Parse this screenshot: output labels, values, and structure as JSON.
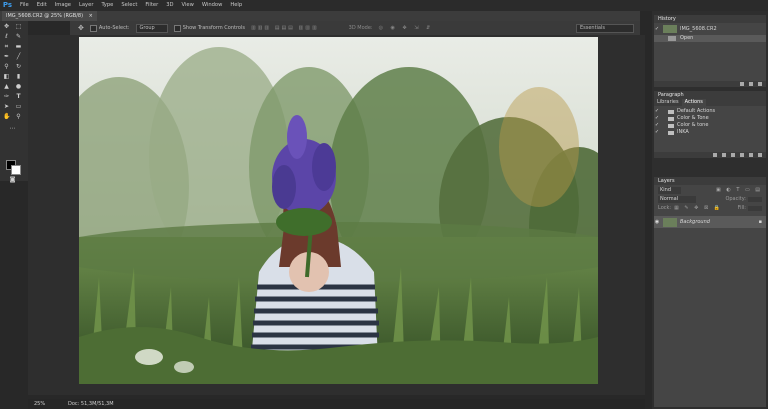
{
  "app": {
    "logo": "Ps",
    "menu": [
      "File",
      "Edit",
      "Image",
      "Layer",
      "Type",
      "Select",
      "Filter",
      "3D",
      "View",
      "Window",
      "Help"
    ]
  },
  "document": {
    "tab_title": "IMG_5608.CR2 @ 25% (RGB/8)",
    "close": "×"
  },
  "options": {
    "auto_select_label": "Auto-Select:",
    "auto_select_value": "Group",
    "show_transform": "Show Transform Controls",
    "mode_3d": "3D Mode:",
    "workspace": "Essentials"
  },
  "status": {
    "zoom": "25%",
    "doc": "Doc: 51,3M/51,3M"
  },
  "history": {
    "title": "History",
    "snapshot": "IMG_5608.CR2",
    "items": [
      "Open"
    ]
  },
  "paragraph": {
    "title": "Paragraph"
  },
  "actions": {
    "tabs": [
      "Libraries",
      "Actions"
    ],
    "items": [
      "Default Actions",
      "Color & Tone",
      "Color & tone",
      "INKA"
    ]
  },
  "layers": {
    "title": "Layers",
    "kind": "Kind",
    "blend": "Normal",
    "opacity_label": "Opacity:",
    "lock_label": "Lock:",
    "fill_label": "Fill:",
    "layer_name": "Background"
  },
  "colors": {
    "accent": "#3d9ae8",
    "panel_bg": "#454545",
    "selected_row": "#5a5a5a"
  }
}
